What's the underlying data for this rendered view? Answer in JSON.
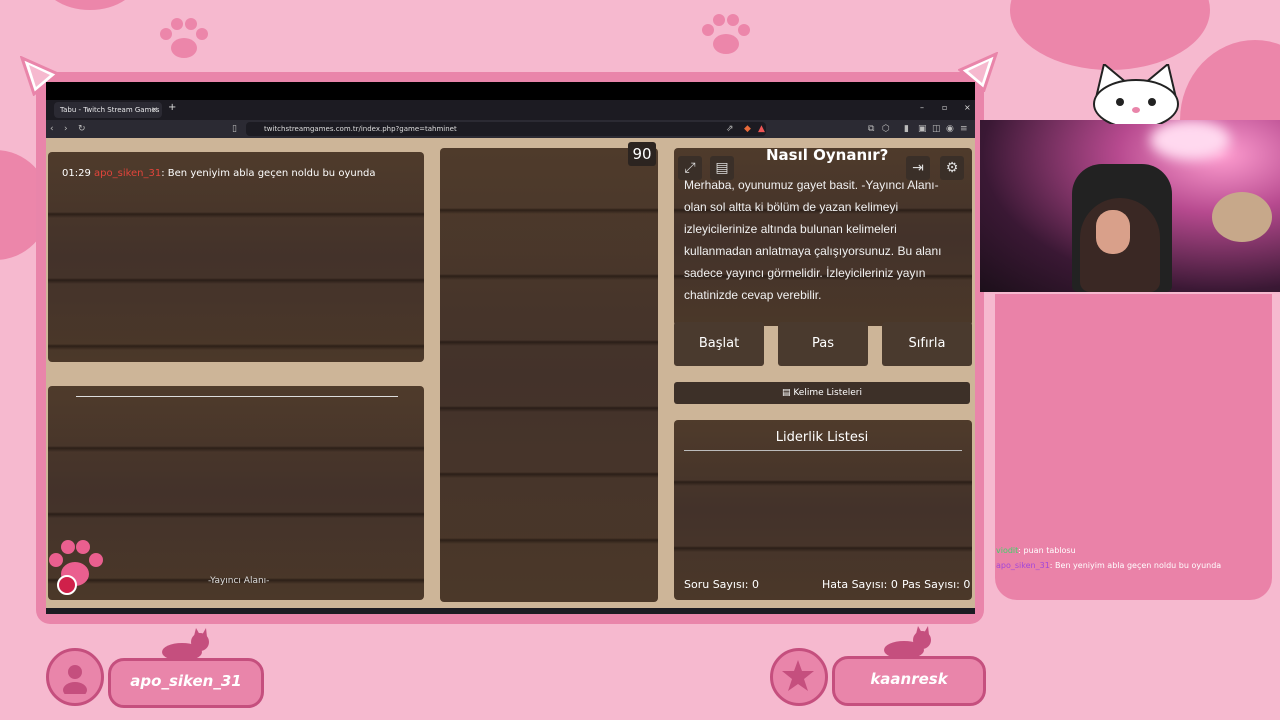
{
  "browser": {
    "tab_title": "Tabu - Twitch Stream Games",
    "tab_close": "×",
    "tab_add": "+",
    "url": "twitchstreamgames.com.tr/index.php?game=tahminet",
    "window_controls": [
      "–",
      "▫",
      "×"
    ]
  },
  "game": {
    "chat_time": "01:29",
    "chat_user": "apo_siken_31",
    "chat_message": ": Ben yeniyim abla geçen noldu bu oyunda",
    "streamer_area_label": "-Yayıncı Alanı-",
    "timer": "90",
    "howto_title": "Nasıl Oynanır?",
    "howto_text": "Merhaba, oyunumuz gayet basit. -Yayıncı Alanı- olan sol altta ki bölüm de yazan kelimeyi izleyicilerinize altında bulunan kelimeleri kullanmadan anlatmaya çalışıyorsunuz. Bu alanı sadece yayıncı görmelidir. İzleyicileriniz yayın chatinizde cevap verebilir.",
    "buttons": {
      "start": "Başlat",
      "pass": "Pas",
      "reset": "Sıfırla"
    },
    "word_lists": "Kelime Listeleri",
    "leaderboard_title": "Liderlik Listesi",
    "stats": {
      "questions": "Soru Sayısı: 0",
      "errors": "Hata Sayısı: 0",
      "passes": "Pas Sayısı: 0"
    },
    "icons": {
      "fullscreen": "fullscreen-icon",
      "notes": "notes-icon",
      "exit": "exit-icon",
      "settings": "gear-icon"
    }
  },
  "stream_chat": [
    {
      "user": "viodit",
      "user_color": "#3fd46a",
      "message": ": puan tablosu"
    },
    {
      "user": "apo_siken_31",
      "user_color": "#a347d9",
      "message": ": Ben yeniyim abla geçen noldu bu oyunda"
    }
  ],
  "overlay": {
    "left_badge": "apo_siken_31",
    "right_badge": "kaanresk"
  },
  "colors": {
    "overlay_pink": "#f6b9cf",
    "accent_pink": "#e985aa",
    "wood": "#4a3728"
  }
}
